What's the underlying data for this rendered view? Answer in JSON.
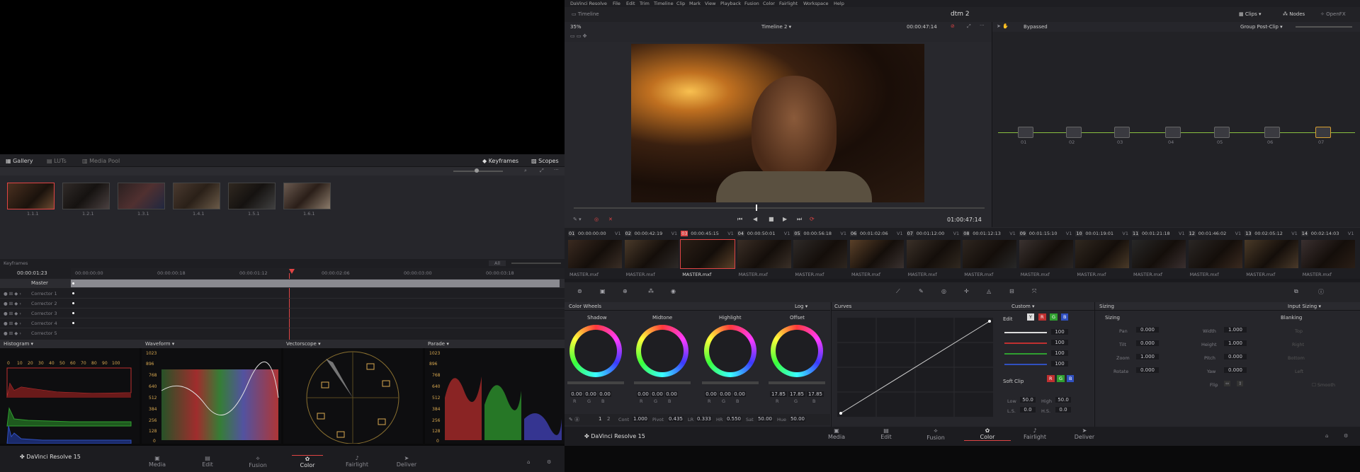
{
  "app": {
    "name": "DaVinci Resolve",
    "project": "dtm 2",
    "brand": "DaVinci Resolve 15"
  },
  "menu": [
    "DaVinci Resolve",
    "File",
    "Edit",
    "Trim",
    "Timeline",
    "Clip",
    "Mark",
    "View",
    "Playback",
    "Fusion",
    "Color",
    "Fairlight",
    "Workspace",
    "Help"
  ],
  "topbar": {
    "timeline_label": "Timeline",
    "clips": "Clips",
    "nodes": "Nodes",
    "openfx": "OpenFX"
  },
  "viewer": {
    "zoom": "35%",
    "timeline_name": "Timeline 2",
    "timecode": "00:00:47:14",
    "playhead_tc": "01:00:47:14",
    "bypass": "Bypassed",
    "group": "Group Post-Clip"
  },
  "gallery": {
    "tabs": [
      "Gallery",
      "LUTs",
      "Media Pool"
    ],
    "keyframes": "Keyframes",
    "scopes": "Scopes",
    "stills": [
      "1.1.1",
      "1.2.1",
      "1.3.1",
      "1.4.1",
      "1.5.1",
      "1.6.1"
    ]
  },
  "keyframes": {
    "label": "Keyframes",
    "filter": "All",
    "tc": "00:00:01:23",
    "ruler": [
      "00:00:00:00",
      "00:00:00:18",
      "00:00:01:12",
      "00:00:02:06",
      "00:00:03:00",
      "00:00:03:18"
    ],
    "tracks": [
      "Master",
      "Corrector 1",
      "Corrector 2",
      "Corrector 3",
      "Corrector 4",
      "Corrector 5"
    ]
  },
  "scopes": {
    "histogram": "Histogram",
    "waveform": "Waveform",
    "vectorscope": "Vectorscope",
    "parade": "Parade",
    "hist_x": [
      "0",
      "10",
      "20",
      "30",
      "40",
      "50",
      "60",
      "70",
      "80",
      "90",
      "100"
    ],
    "levels": [
      "1023",
      "896",
      "768",
      "640",
      "512",
      "384",
      "256",
      "128",
      "0"
    ]
  },
  "clips": [
    {
      "n": "01",
      "tc": "00:00:00:00",
      "t": "V1",
      "name": "MASTER.mxf"
    },
    {
      "n": "02",
      "tc": "00:00:42:19",
      "t": "V1",
      "name": "MASTER.mxf"
    },
    {
      "n": "03",
      "tc": "00:00:45:15",
      "t": "V1",
      "name": "MASTER.mxf"
    },
    {
      "n": "04",
      "tc": "00:00:50:01",
      "t": "V1",
      "name": "MASTER.mxf"
    },
    {
      "n": "05",
      "tc": "00:00:56:18",
      "t": "V1",
      "name": "MASTER.mxf"
    },
    {
      "n": "06",
      "tc": "00:01:02:06",
      "t": "V1",
      "name": "MASTER.mxf"
    },
    {
      "n": "07",
      "tc": "00:01:12:00",
      "t": "V1",
      "name": "MASTER.mxf"
    },
    {
      "n": "08",
      "tc": "00:01:12:13",
      "t": "V1",
      "name": "MASTER.mxf"
    },
    {
      "n": "09",
      "tc": "00:01:15:10",
      "t": "V1",
      "name": "MASTER.mxf"
    },
    {
      "n": "10",
      "tc": "00:01:19:01",
      "t": "V1",
      "name": "MASTER.mxf"
    },
    {
      "n": "11",
      "tc": "00:01:21:18",
      "t": "V1",
      "name": "MASTER.mxf"
    },
    {
      "n": "12",
      "tc": "00:01:46:02",
      "t": "V1",
      "name": "MASTER.mxf"
    },
    {
      "n": "13",
      "tc": "00:02:05:12",
      "t": "V1",
      "name": "MASTER.mxf"
    },
    {
      "n": "14",
      "tc": "00:02:14:03",
      "t": "V1",
      "name": "MASTER.mxf"
    }
  ],
  "nodes": [
    "01",
    "02",
    "03",
    "04",
    "05",
    "06",
    "07"
  ],
  "wheels": {
    "title": "Color Wheels",
    "mode": "Log",
    "items": [
      {
        "name": "Shadow",
        "r": "0.00",
        "g": "0.00",
        "b": "0.00"
      },
      {
        "name": "Midtone",
        "r": "0.00",
        "g": "0.00",
        "b": "0.00"
      },
      {
        "name": "Highlight",
        "r": "0.00",
        "g": "0.00",
        "b": "0.00"
      },
      {
        "name": "Offset",
        "r": "17.85",
        "g": "17.85",
        "b": "17.85"
      }
    ],
    "rgb": [
      "R",
      "G",
      "B"
    ],
    "bottom": {
      "p1": "1",
      "p2": "2",
      "cont_l": "Cont",
      "cont": "1.000",
      "pivot_l": "Pivot",
      "pivot": "0.435",
      "lr_l": "LR",
      "lr": "0.333",
      "hr_l": "HR",
      "hr": "0.550",
      "sat_l": "Sat",
      "sat": "50.00",
      "hue_l": "Hue",
      "hue": "50.00"
    }
  },
  "curves": {
    "title": "Curves",
    "mode": "Custom",
    "edit": "Edit",
    "y": "Y",
    "r": "R",
    "g": "G",
    "b": "B",
    "vals": [
      "100",
      "100",
      "100",
      "100"
    ],
    "softclip": "Soft Clip",
    "low_l": "Low",
    "low": "50.0",
    "high_l": "High",
    "high": "50.0",
    "ls_l": "L.S.",
    "ls": "0.0",
    "hs_l": "H.S.",
    "hs": "0.0"
  },
  "sizing": {
    "title": "Sizing",
    "mode": "Input Sizing",
    "sub": "Sizing",
    "blanking": "Blanking",
    "left": [
      {
        "k": "Pan",
        "v": "0.000"
      },
      {
        "k": "Tilt",
        "v": "0.000"
      },
      {
        "k": "Zoom",
        "v": "1.000"
      },
      {
        "k": "Rotate",
        "v": "0.000"
      }
    ],
    "mid": [
      {
        "k": "Width",
        "v": "1.000"
      },
      {
        "k": "Height",
        "v": "1.000"
      },
      {
        "k": "Pitch",
        "v": "0.000"
      },
      {
        "k": "Yaw",
        "v": "0.000"
      },
      {
        "k": "Flip",
        "v": ""
      }
    ],
    "blank": [
      "Top",
      "Right",
      "Bottom",
      "Left"
    ],
    "smooth": "Smooth"
  },
  "pages": [
    "Media",
    "Edit",
    "Fusion",
    "Color",
    "Fairlight",
    "Deliver"
  ],
  "colors": {
    "accent": "#e04444",
    "panel": "#28282d"
  }
}
